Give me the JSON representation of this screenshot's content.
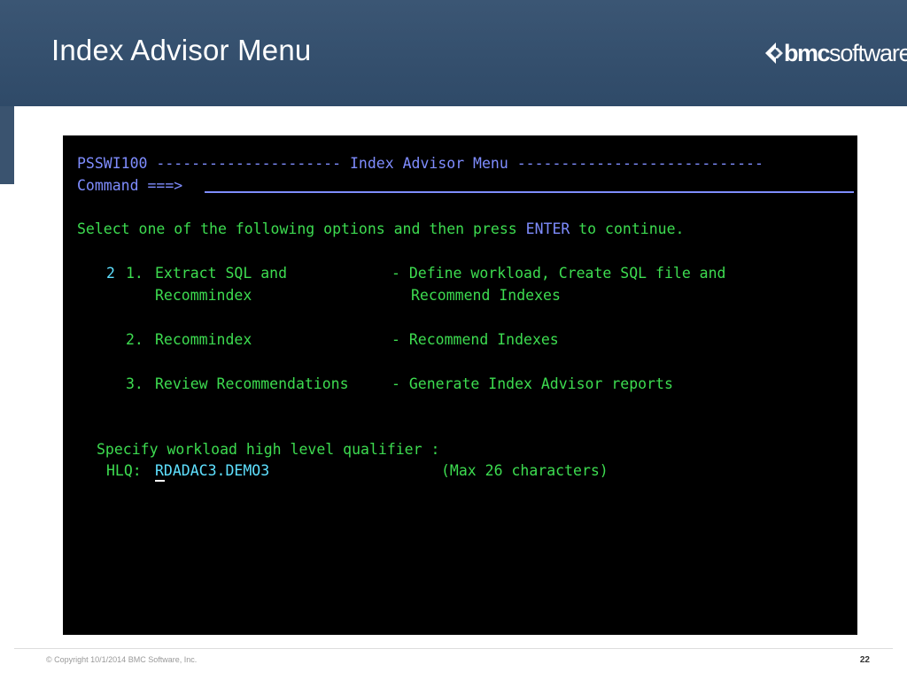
{
  "slide": {
    "title": "Index Advisor Menu",
    "logo_bmc": "bmc",
    "logo_software": "software",
    "footer_copyright": "© Copyright 10/1/2014 BMC Software, Inc.",
    "page_number": "22"
  },
  "terminal": {
    "line1_panel_id": "PSSWI100",
    "line1_dashes_left": "---------------------",
    "line1_title": "Index Advisor Menu",
    "line1_dashes_right": "----------------------------",
    "command_label": "Command ===>",
    "instruction_prefix": "Select one of the following options and then press",
    "instruction_key": "ENTER",
    "instruction_suffix": "to continue.",
    "selection_value": "2",
    "options": [
      {
        "number": "1.",
        "name_line1": "Extract SQL and",
        "name_line2": "Recommindex",
        "desc_line1": "- Define workload, Create SQL file and",
        "desc_line2": "Recommend Indexes"
      },
      {
        "number": "2.",
        "name_line1": "Recommindex",
        "desc_line1": "- Recommend Indexes"
      },
      {
        "number": "3.",
        "name_line1": "Review Recommendations",
        "desc_line1": "- Generate Index Advisor reports"
      }
    ],
    "hlq_prompt": "Specify workload high level qualifier :",
    "hlq_label": "HLQ:",
    "hlq_value": "RDADAC3.DEMO3",
    "hlq_hint": "(Max 26 characters)"
  },
  "colors": {
    "header_bg": "#2f4a68",
    "terminal_bg": "#000000",
    "text_blue": "#7f8dff",
    "text_green": "#3ddc50",
    "text_cyan": "#5ee0ff"
  },
  "icons": {
    "logo_mark": "bmc-logo-icon"
  }
}
